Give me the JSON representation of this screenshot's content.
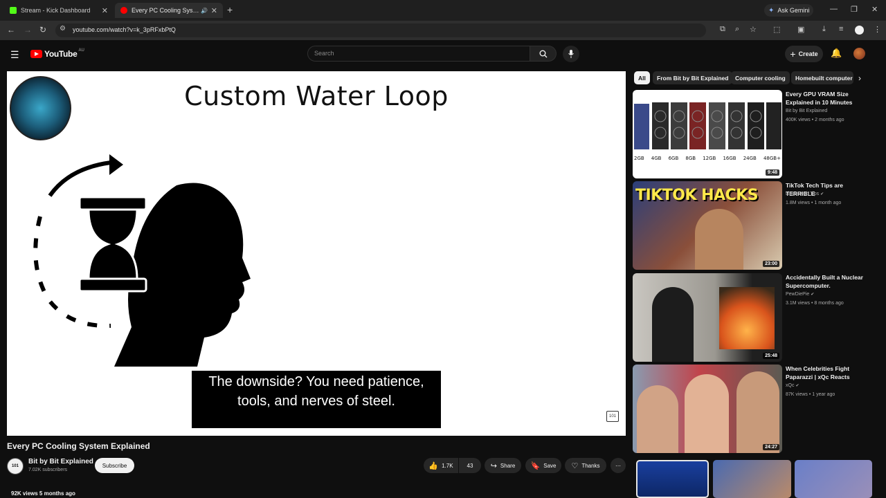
{
  "browser": {
    "tabs": [
      {
        "title": "Stream - Kick Dashboard",
        "active": false,
        "favicon_color": "#53fc18"
      },
      {
        "title": "Every PC Cooling System Ex",
        "active": true,
        "favicon_color": "#ff0000"
      }
    ],
    "new_tab_icon": "plus-icon",
    "ask_gemini": "Ask Gemini",
    "url": "youtube.com/watch?v=k_3pRFxbPtQ"
  },
  "youtube_header": {
    "logo_text": "YouTube",
    "country_code": "AU",
    "search_placeholder": "Search",
    "create_label": "Create"
  },
  "video": {
    "slide_title": "Custom Water Loop",
    "caption": "The downside? You need patience, tools, and nerves of steel.",
    "watermark": "101"
  },
  "below_video": {
    "title": "Every PC Cooling System Explained",
    "channel_name": "Bit by Bit Explained",
    "subscribers": "7.02K subscribers",
    "subscribe_label": "Subscribe",
    "likes": "1.7K",
    "dislikes": "43",
    "share_label": "Share",
    "save_label": "Save",
    "thanks_label": "Thanks",
    "views": "92K views  5 months ago"
  },
  "sidebar": {
    "chips": [
      "All",
      "From Bit by Bit Explained",
      "Computer cooling",
      "Homebuilt computer"
    ],
    "recommendations": [
      {
        "title": "Every GPU VRAM Size Explained in 10 Minutes",
        "channel": "Bit by Bit Explained",
        "meta": "400K views • 2 months ago",
        "duration": "9:48",
        "verified": false
      },
      {
        "title": "TikTok Tech Tips are TERRIBLE",
        "channel": "Linus Tech Tips",
        "meta": "1.8M views • 1 month ago",
        "duration": "23:00",
        "verified": true,
        "thumb_text": "TIKTOK HACKS"
      },
      {
        "title": "Accidentally Built a Nuclear Supercomputer.",
        "channel": "PewDiePie",
        "meta": "3.1M views • 8 months ago",
        "duration": "25:48",
        "verified": true
      },
      {
        "title": "When Celebrities Fight Paparazzi | xQc Reacts",
        "channel": "xQc",
        "meta": "87K views • 1 year ago",
        "duration": "24:27",
        "verified": true
      }
    ],
    "gpu_sizes": [
      "2GB",
      "4GB",
      "6GB",
      "8GB",
      "12GB",
      "16GB",
      "24GB",
      "48GB+"
    ]
  }
}
